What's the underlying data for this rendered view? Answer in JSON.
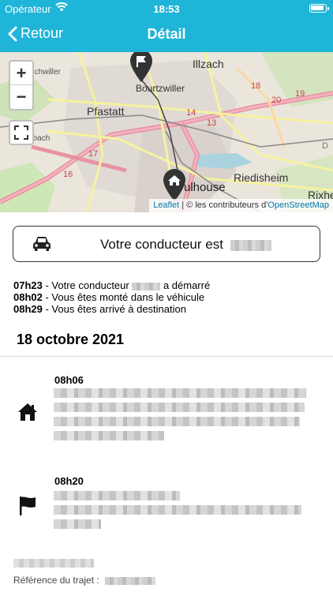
{
  "status_bar": {
    "carrier": "Opérateur",
    "time": "18:53"
  },
  "nav": {
    "back_label": "Retour",
    "title": "Détail"
  },
  "map": {
    "attribution_link": "Leaflet",
    "attribution_separator": " | © les contributeurs d'",
    "attribution_osm": "OpenStreetMap",
    "zoom_in": "+",
    "zoom_out": "−",
    "places": [
      "Richwiller",
      "Bourtzwiller",
      "Illzach",
      "Pfastatt",
      "Lutterbach",
      "Riedisheim",
      "Rixhe",
      "ulhouse"
    ],
    "road_numbers": [
      "18",
      "19",
      "20",
      "17",
      "16",
      "14",
      "13"
    ]
  },
  "driver_card": {
    "label": "Votre conducteur est"
  },
  "events": [
    {
      "time": "07h23",
      "text": " - Votre conducteur ",
      "text_after": " a démarré"
    },
    {
      "time": "08h02",
      "text": " - Vous êtes monté dans le véhicule"
    },
    {
      "time": "08h29",
      "text": " - Vous êtes arrivé à destination"
    }
  ],
  "date_heading": "18 octobre 2021",
  "stops": [
    {
      "time": "08h06",
      "icon": "home-icon"
    },
    {
      "time": "08h20",
      "icon": "flag-icon"
    }
  ],
  "reference_label": "Référence du trajet :",
  "colors": {
    "header": "#1fb5d8",
    "accent_link": "#0078a8"
  }
}
